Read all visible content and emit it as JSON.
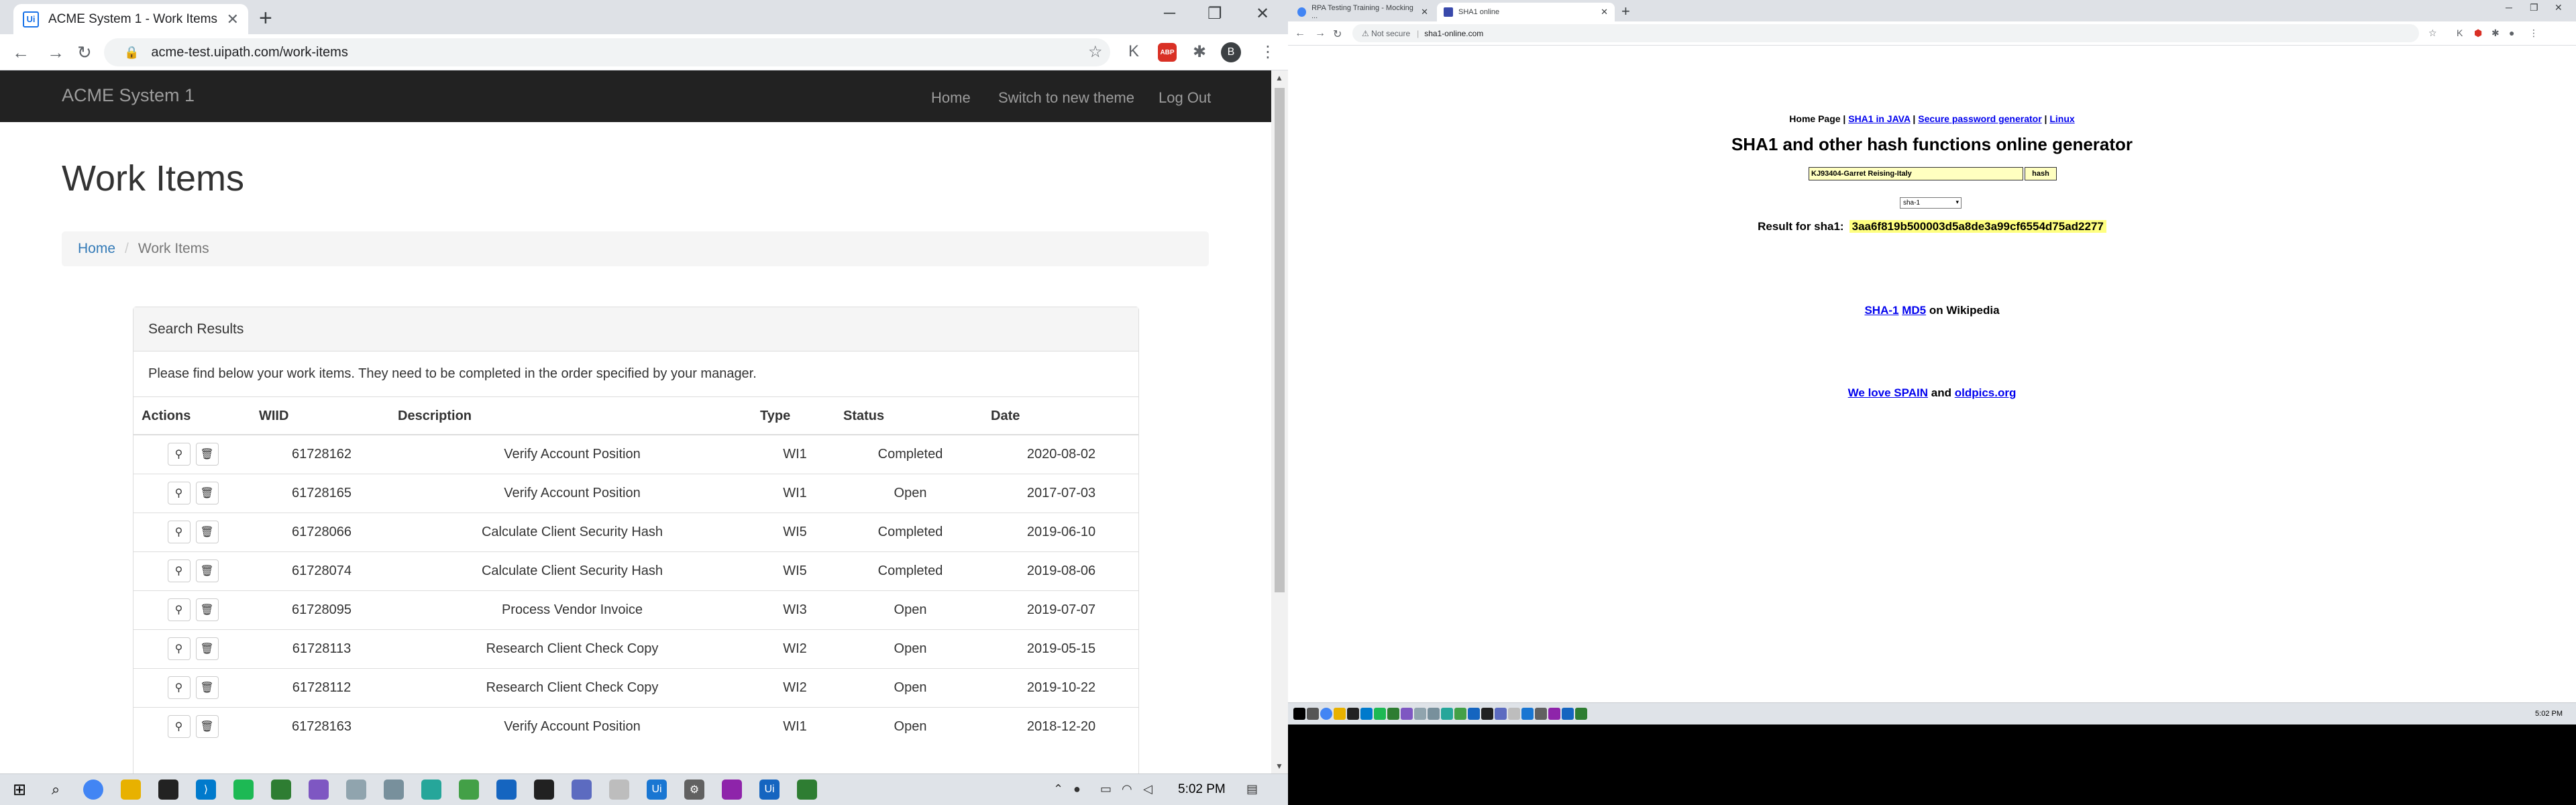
{
  "left_browser": {
    "tab_title": "ACME System 1 - Work Items",
    "url": "acme-test.uipath.com/work-items",
    "brand": "ACME System 1",
    "nav": [
      "Home",
      "Switch to new theme",
      "Log Out"
    ],
    "page_title": "Work Items",
    "breadcrumb": {
      "home": "Home",
      "current": "Work Items"
    },
    "panel_heading": "Search Results",
    "panel_text": "Please find below your work items. They need to be completed in the order specified by your manager.",
    "columns": [
      "Actions",
      "WIID",
      "Description",
      "Type",
      "Status",
      "Date"
    ],
    "rows": [
      {
        "wiid": "61728162",
        "description": "Verify Account Position",
        "type": "WI1",
        "status": "Completed",
        "date": "2020-08-02"
      },
      {
        "wiid": "61728165",
        "description": "Verify Account Position",
        "type": "WI1",
        "status": "Open",
        "date": "2017-07-03"
      },
      {
        "wiid": "61728066",
        "description": "Calculate Client Security Hash",
        "type": "WI5",
        "status": "Completed",
        "date": "2019-06-10"
      },
      {
        "wiid": "61728074",
        "description": "Calculate Client Security Hash",
        "type": "WI5",
        "status": "Completed",
        "date": "2019-08-06"
      },
      {
        "wiid": "61728095",
        "description": "Process Vendor Invoice",
        "type": "WI3",
        "status": "Open",
        "date": "2019-07-07"
      },
      {
        "wiid": "61728113",
        "description": "Research Client Check Copy",
        "type": "WI2",
        "status": "Open",
        "date": "2019-05-15"
      },
      {
        "wiid": "61728112",
        "description": "Research Client Check Copy",
        "type": "WI2",
        "status": "Open",
        "date": "2019-10-22"
      },
      {
        "wiid": "61728163",
        "description": "Verify Account Position",
        "type": "WI1",
        "status": "Open",
        "date": "2018-12-20"
      }
    ],
    "clock": "5:02 PM"
  },
  "right_browser": {
    "tabs": [
      "RPA Testing Training - Mocking ...",
      "SHA1 online"
    ],
    "not_secure": "Not secure",
    "url": "sha1-online.com",
    "links_prefix": "Home Page |",
    "links": [
      "SHA1 in JAVA",
      "Secure password generator",
      "Linux"
    ],
    "title": "SHA1 and other hash functions online generator",
    "input_value": "KJ93404-Garret Reising-Italy",
    "hash_button": "hash",
    "algorithm": "sha-1",
    "result_label": "Result for sha1:",
    "result_hash": "3aa6f819b500003d5a8de3a99cf6554d75ad2277",
    "wiki_links": [
      "SHA-1",
      "MD5"
    ],
    "wiki_suffix": "on Wikipedia",
    "spain_link": "We love SPAIN",
    "and_text": "and",
    "oldpics_link": "oldpics.org",
    "clock": "5:02 PM"
  },
  "colors": {
    "navbar": "#222222",
    "link": "#337ab7",
    "hash_highlight": "#ffff80",
    "input_bg": "#ffffc0"
  }
}
